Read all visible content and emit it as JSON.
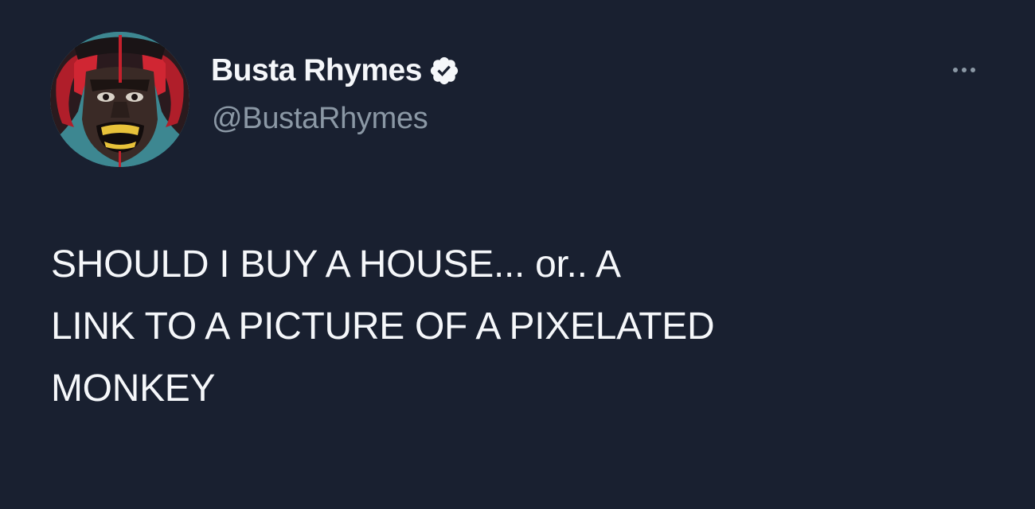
{
  "tweet": {
    "author": {
      "display_name": "Busta Rhymes",
      "handle": "@BustaRhymes",
      "verified": true,
      "avatar_icon": "avatar-illustration"
    },
    "more_options_icon": "more-icon",
    "text_lines": [
      "SHOULD I BUY A HOUSE... or.. A",
      "LINK TO A PICTURE OF A PIXELATED",
      "MONKEY"
    ]
  },
  "colors": {
    "background": "#192030",
    "primary_text": "#f5f7fa",
    "secondary_text": "#8b98a5"
  }
}
